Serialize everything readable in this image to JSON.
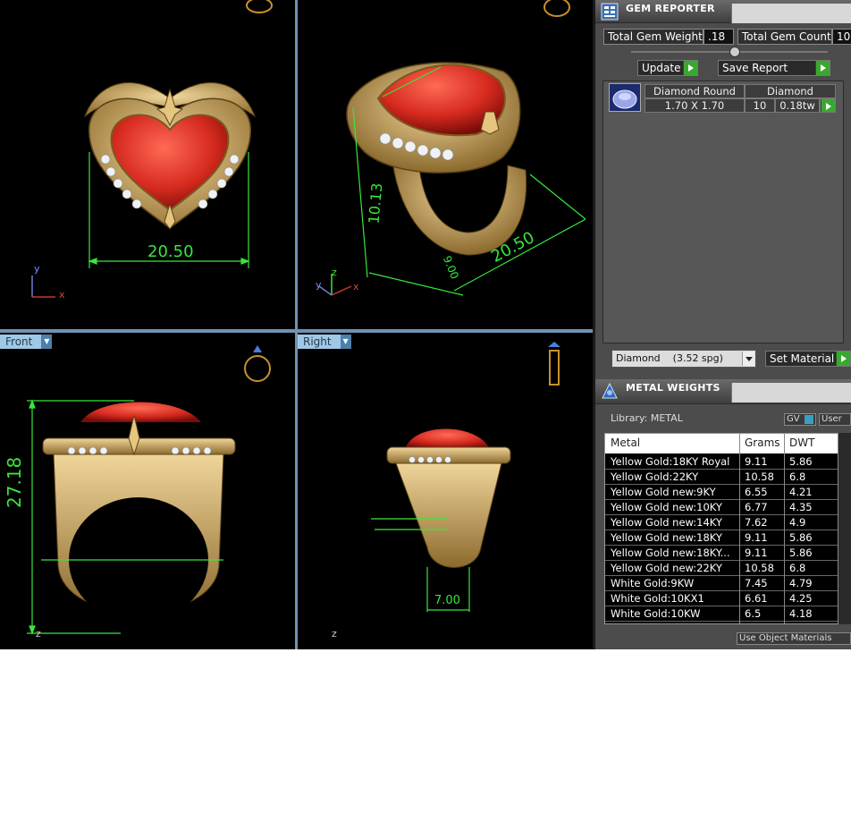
{
  "viewports": {
    "top_left": {
      "dimension": "20.50",
      "axis_x": "x",
      "axis_y": "y"
    },
    "top_right": {
      "dim_width": "20.50",
      "dim_height": "10.13",
      "dim_depth": "9.00",
      "axis_x": "x",
      "axis_y": "y",
      "axis_z": "z"
    },
    "bottom_left": {
      "label": "Front",
      "dimension": "27.18",
      "axis_z": "z"
    },
    "bottom_right": {
      "label": "Right",
      "dimension": "7.00",
      "axis_z": "z"
    }
  },
  "gem_reporter": {
    "title": "GEM REPORTER",
    "total_weight_label": "Total Gem Weight",
    "total_weight_value": ".18",
    "total_count_label": "Total Gem Count",
    "total_count_value": "10",
    "update_button": "Update",
    "save_report_button": "Save Report",
    "gem_row": {
      "name": "Diamond Round",
      "type": "Diamond",
      "size": "1.70 X 1.70",
      "count": "10",
      "weight": "0.18tw"
    },
    "material_select": "Diamond    (3.52 spg)",
    "set_material_button": "Set Material"
  },
  "metal_weights": {
    "title": "METAL WEIGHTS",
    "library_label": "Library: METAL",
    "gv_button": "GV",
    "user_button": "User",
    "columns": [
      "Metal",
      "Grams",
      "DWT"
    ],
    "rows": [
      [
        "Yellow Gold:18KY Royal",
        "9.11",
        "5.86"
      ],
      [
        "Yellow Gold:22KY",
        "10.58",
        "6.8"
      ],
      [
        "Yellow Gold new:9KY",
        "6.55",
        "4.21"
      ],
      [
        "Yellow Gold new:10KY",
        "6.77",
        "4.35"
      ],
      [
        "Yellow Gold new:14KY",
        "7.62",
        "4.9"
      ],
      [
        "Yellow Gold new:18KY",
        "9.11",
        "5.86"
      ],
      [
        "Yellow Gold new:18KY...",
        "9.11",
        "5.86"
      ],
      [
        "Yellow Gold new:22KY",
        "10.58",
        "6.8"
      ],
      [
        "White Gold:9KW",
        "7.45",
        "4.79"
      ],
      [
        "White Gold:10KX1",
        "6.61",
        "4.25"
      ],
      [
        "White Gold:10KW",
        "6.5",
        "4.18"
      ]
    ],
    "use_object_materials": "Use Object Materials"
  },
  "colors": {
    "dimension_green": "#39e639",
    "gold": "#d9b36a",
    "gem_red": "#d62a1f",
    "panel_bg": "#4c4c4c",
    "label_blue": "#9fc8e6"
  }
}
